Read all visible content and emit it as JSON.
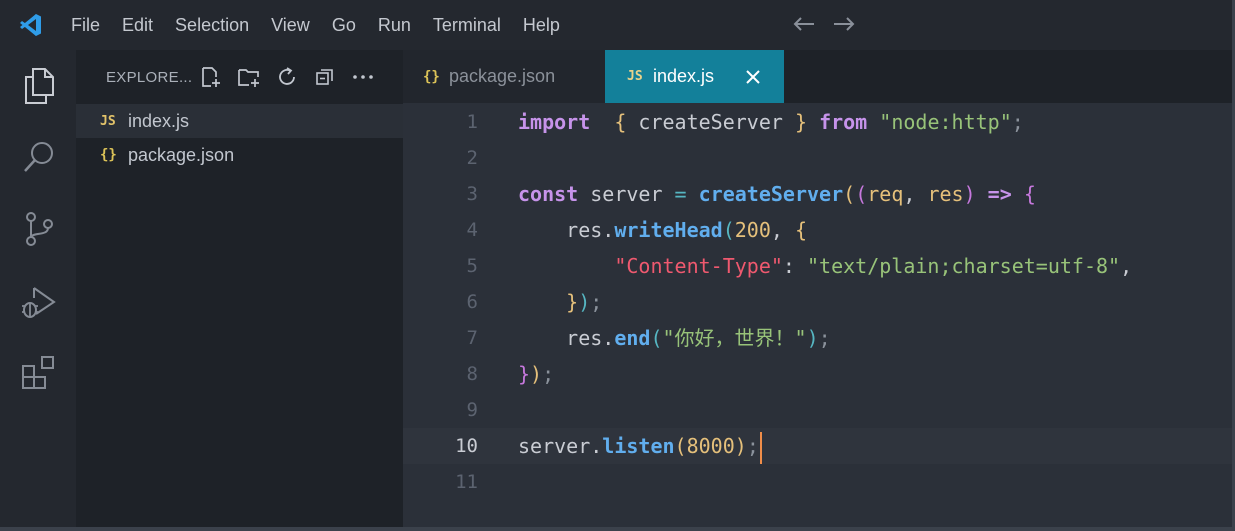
{
  "menu": [
    "File",
    "Edit",
    "Selection",
    "View",
    "Go",
    "Run",
    "Terminal",
    "Help"
  ],
  "sidebar": {
    "title": "EXPLORE...",
    "files": [
      {
        "icon": "JS",
        "name": "index.js",
        "active": true
      },
      {
        "icon": "{}",
        "name": "package.json",
        "active": false
      }
    ]
  },
  "tabs": [
    {
      "icon": "{}",
      "label": "package.json",
      "active": false
    },
    {
      "icon": "JS",
      "label": "index.js",
      "active": true
    }
  ],
  "editor": {
    "current_line": 10,
    "line_numbers": [
      "1",
      "2",
      "3",
      "4",
      "5",
      "6",
      "7",
      "8",
      "9",
      "10",
      "11"
    ],
    "lines": [
      [
        [
          "kw",
          "import"
        ],
        [
          "",
          "  "
        ],
        [
          "br1",
          "{"
        ],
        [
          "",
          " createServer "
        ],
        [
          "br1",
          "}"
        ],
        [
          "",
          " "
        ],
        [
          "kw",
          "from"
        ],
        [
          "",
          " "
        ],
        [
          "str",
          "\"node:http\""
        ],
        [
          "punc",
          ";"
        ]
      ],
      [],
      [
        [
          "kw",
          "const"
        ],
        [
          "",
          " server "
        ],
        [
          "op",
          "="
        ],
        [
          "",
          " "
        ],
        [
          "fn",
          "createServer"
        ],
        [
          "br1",
          "("
        ],
        [
          "br2",
          "("
        ],
        [
          "param",
          "req"
        ],
        [
          "",
          ", "
        ],
        [
          "param",
          "res"
        ],
        [
          "br2",
          ")"
        ],
        [
          "",
          " "
        ],
        [
          "kw",
          "=>"
        ],
        [
          "",
          " "
        ],
        [
          "br2",
          "{"
        ]
      ],
      [
        [
          "",
          "    res."
        ],
        [
          "fn",
          "writeHead"
        ],
        [
          "br3",
          "("
        ],
        [
          "num",
          "200"
        ],
        [
          "",
          ", "
        ],
        [
          "br1",
          "{"
        ]
      ],
      [
        [
          "",
          "        "
        ],
        [
          "key",
          "\"Content-Type\""
        ],
        [
          "",
          ": "
        ],
        [
          "str",
          "\"text/plain;charset=utf-8\""
        ],
        [
          "",
          ","
        ]
      ],
      [
        [
          "",
          "    "
        ],
        [
          "br1",
          "}"
        ],
        [
          "br3",
          ")"
        ],
        [
          "punc",
          ";"
        ]
      ],
      [
        [
          "",
          "    res."
        ],
        [
          "fn",
          "end"
        ],
        [
          "br3",
          "("
        ],
        [
          "str",
          "\"你好，世界！\""
        ],
        [
          "br3",
          ")"
        ],
        [
          "punc",
          ";"
        ]
      ],
      [
        [
          "br2",
          "}"
        ],
        [
          "br1",
          ")"
        ],
        [
          "punc",
          ";"
        ]
      ],
      [],
      [
        [
          "",
          "server."
        ],
        [
          "fn",
          "listen"
        ],
        [
          "br1",
          "("
        ],
        [
          "num",
          "8000"
        ],
        [
          "br1",
          ")"
        ],
        [
          "punc",
          ";"
        ]
      ],
      []
    ]
  },
  "colors": {
    "accent_tab": "#13809a",
    "cursor": "#f08d49",
    "logo": "#2f9ce8"
  }
}
